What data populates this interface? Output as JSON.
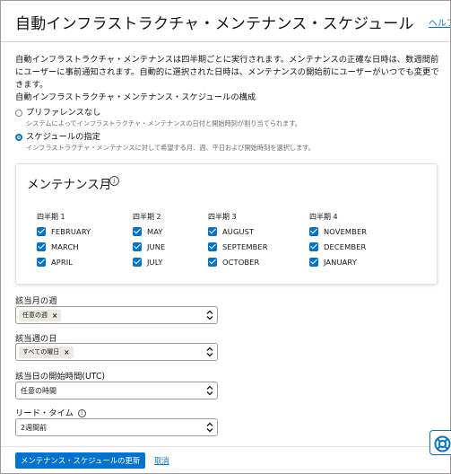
{
  "dialog": {
    "title": "自動インフラストラクチャ・メンテナンス・スケジュール",
    "help_link": "ヘルプ"
  },
  "intro": "自動インフラストラクチャ・メンテナンスは四半期ごとに実行されます。メンテナンスの正確な日時は、数週間前にユーザーに事前通知されます。自動的に選択された日時は、メンテナンスの開始前にユーザーがいつでも変更できます。",
  "schedule_config": {
    "label": "自動インフラストラクチャ・メンテナンス・スケジュールの構成",
    "options": [
      {
        "label": "プリファレンスなし",
        "help": "システムによってインフラストラクチャ・メンテナンスの日付と開始時刻が割り当てられます。",
        "selected": false
      },
      {
        "label": "スケジュールの指定",
        "help": "インフラストラクチャ・メンテナンスに対して希望する月、週、平日および開始時刻を選択します。",
        "selected": true
      }
    ]
  },
  "maintenance_months": {
    "title": "メンテナンス月",
    "info_icon": "info-icon",
    "quarters": [
      {
        "label": "四半期 1",
        "months": [
          "FEBRUARY",
          "MARCH",
          "APRIL"
        ]
      },
      {
        "label": "四半期 2",
        "months": [
          "MAY",
          "JUNE",
          "JULY"
        ]
      },
      {
        "label": "四半期 3",
        "months": [
          "AUGUST",
          "SEPTEMBER",
          "OCTOBER"
        ]
      },
      {
        "label": "四半期 4",
        "months": [
          "NOVEMBER",
          "DECEMBER",
          "JANUARY"
        ]
      }
    ]
  },
  "fields": {
    "week_of_month": {
      "label": "該当月の週",
      "chip": "任意の週"
    },
    "day_of_week": {
      "label": "該当週の日",
      "chip": "すべての曜日"
    },
    "start_time": {
      "label": "該当日の開始時間(UTC)",
      "value": "任意の時間"
    },
    "lead_time": {
      "label": "リード・タイム",
      "value": "2週間前"
    }
  },
  "footer": {
    "update_button": "メンテナンス・スケジュールの更新",
    "cancel_link": "取消"
  },
  "colors": {
    "accent": "#0572ce",
    "text": "#161513",
    "muted": "#6f6b66"
  }
}
